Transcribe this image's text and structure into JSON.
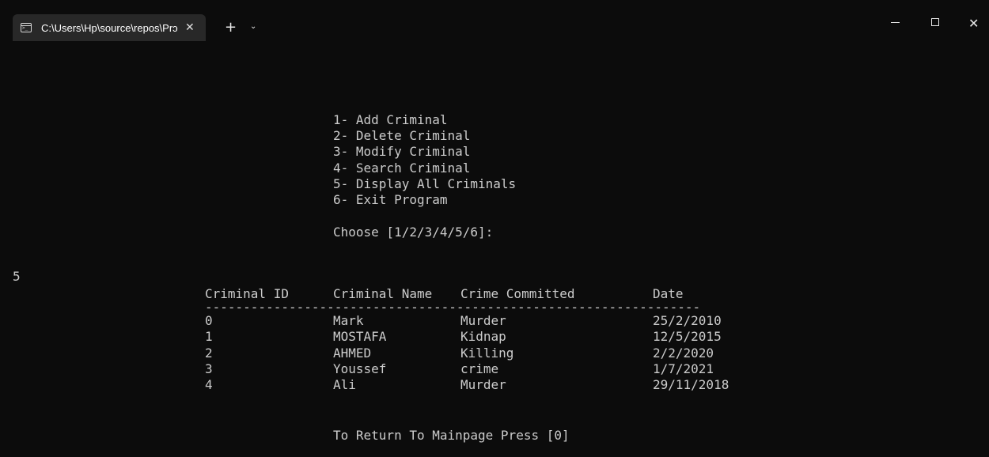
{
  "window": {
    "tab_title": "C:\\Users\\Hp\\source\\repos\\Prɔ",
    "tab_close": "✕",
    "new_tab": "+",
    "dropdown": "⌄",
    "close": "✕"
  },
  "console": {
    "menu": [
      "1- Add Criminal",
      "2- Delete Criminal",
      "3- Modify Criminal",
      "4- Search Criminal",
      "5- Display All Criminals",
      "6- Exit Program"
    ],
    "prompt": "Choose [1/2/3/4/5/6]:",
    "input": "5",
    "table": {
      "headers": [
        "Criminal ID",
        "Criminal Name",
        "Crime Committed",
        "Date"
      ],
      "separator": "-----------------------------------------------------------------",
      "rows": [
        [
          "0",
          "Mark",
          "Murder",
          "25/2/2010"
        ],
        [
          "1",
          "MOSTAFA",
          "Kidnap",
          "12/5/2015"
        ],
        [
          "2",
          "AHMED",
          "Killing",
          "2/2/2020"
        ],
        [
          "3",
          "Youssef",
          "crime",
          "1/7/2021"
        ],
        [
          "4",
          "Ali",
          "Murder",
          "29/11/2018"
        ]
      ]
    },
    "footer": "To Return To Mainpage Press [0]"
  },
  "icons": {
    "tab_icon": "console-app-icon",
    "minimize": "minimize-icon",
    "maximize": "maximize-icon",
    "close": "close-icon"
  },
  "colors": {
    "background": "#0c0c0c",
    "tab": "#282828",
    "text": "#cccccc"
  }
}
